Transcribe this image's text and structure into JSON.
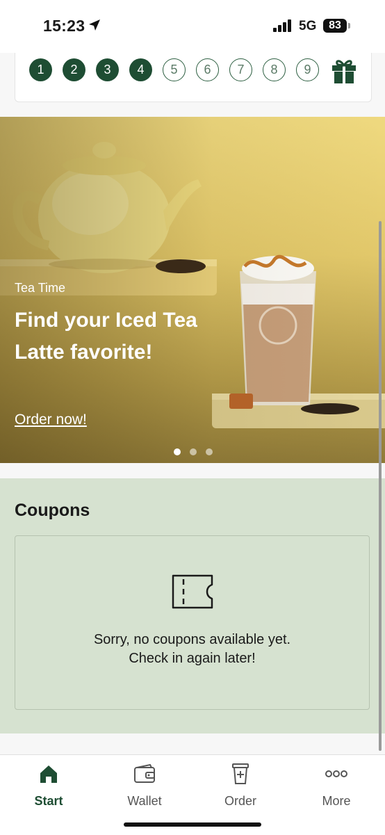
{
  "status_bar": {
    "time": "15:23",
    "network": "5G",
    "battery": "83"
  },
  "stamp_card": {
    "stamps": [
      {
        "label": "1",
        "filled": true
      },
      {
        "label": "2",
        "filled": true
      },
      {
        "label": "3",
        "filled": true
      },
      {
        "label": "4",
        "filled": true
      },
      {
        "label": "5",
        "filled": false
      },
      {
        "label": "6",
        "filled": false
      },
      {
        "label": "7",
        "filled": false
      },
      {
        "label": "8",
        "filled": false
      },
      {
        "label": "9",
        "filled": false
      }
    ],
    "reward_icon": "gift-icon"
  },
  "banner": {
    "kicker": "Tea Time",
    "headline": "Find your Iced Tea Latte favorite!",
    "cta": "Order now!",
    "slides_total": 3,
    "active_slide": 1
  },
  "coupons": {
    "title": "Coupons",
    "icon": "ticket-icon",
    "empty_line1": "Sorry, no coupons available yet.",
    "empty_line2": "Check in again later!"
  },
  "tab_bar": {
    "tabs": [
      {
        "label": "Start",
        "icon": "home-icon",
        "active": true
      },
      {
        "label": "Wallet",
        "icon": "wallet-icon",
        "active": false
      },
      {
        "label": "Order",
        "icon": "cup-icon",
        "active": false
      },
      {
        "label": "More",
        "icon": "more-icon",
        "active": false
      }
    ]
  },
  "colors": {
    "brand_green": "#1e4d33",
    "coupons_bg": "#d6e2d0",
    "banner_yellow": "#efd97f"
  }
}
